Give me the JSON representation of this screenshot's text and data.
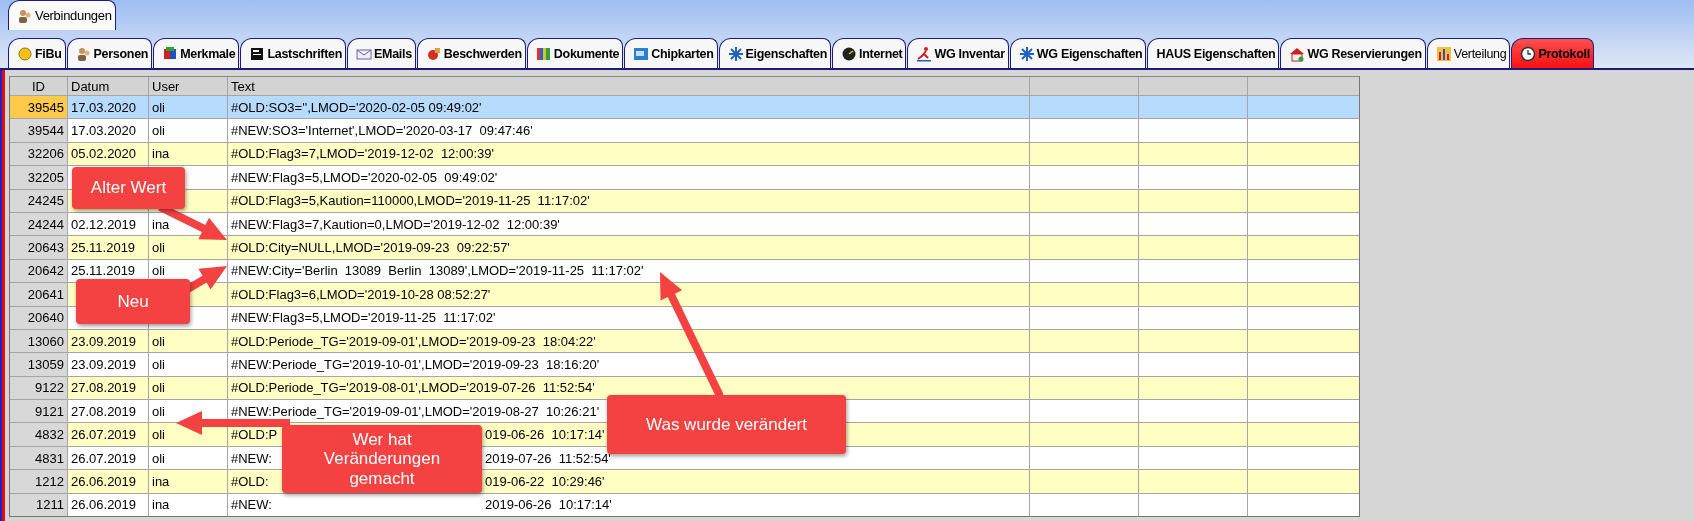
{
  "top_tabs": [
    {
      "label": "Verbindungen",
      "selected": true
    }
  ],
  "tabs": [
    {
      "label": "FiBu",
      "selected": false,
      "bold": true,
      "icon": true
    },
    {
      "label": "Personen",
      "selected": false,
      "bold": true,
      "icon": true
    },
    {
      "label": "Merkmale",
      "selected": false,
      "bold": true,
      "icon": true
    },
    {
      "label": "Lastschriften",
      "selected": false,
      "bold": true,
      "icon": true
    },
    {
      "label": "EMails",
      "selected": false,
      "bold": true,
      "icon": true
    },
    {
      "label": "Beschwerden",
      "selected": false,
      "bold": true,
      "icon": true
    },
    {
      "label": "Dokumente",
      "selected": false,
      "bold": true,
      "icon": true
    },
    {
      "label": "Chipkarten",
      "selected": false,
      "bold": true,
      "icon": true
    },
    {
      "label": "Eigenschaften",
      "selected": false,
      "bold": true,
      "icon": true
    },
    {
      "label": "Internet",
      "selected": false,
      "bold": true,
      "icon": true
    },
    {
      "label": "WG Inventar",
      "selected": false,
      "bold": true,
      "icon": true
    },
    {
      "label": "WG Eigenschaften",
      "selected": false,
      "bold": true,
      "icon": true
    },
    {
      "label": "HAUS Eigenschaften",
      "selected": false,
      "bold": true,
      "icon": false
    },
    {
      "label": "WG Reservierungen",
      "selected": false,
      "bold": true,
      "icon": true
    },
    {
      "label": "Verteilung",
      "selected": false,
      "bold": false,
      "icon": true
    },
    {
      "label": "Protokoll",
      "selected": true,
      "bold": true,
      "icon": true
    }
  ],
  "table": {
    "columns": [
      "ID",
      "Datum",
      "User",
      "Text"
    ],
    "rows": [
      {
        "id": "39545",
        "date": "17.03.2020",
        "user": "oli",
        "text": "#OLD:SO3='',LMOD='2020-02-05 09:49:02'",
        "selected": true
      },
      {
        "id": "39544",
        "date": "17.03.2020",
        "user": "oli",
        "text": "#NEW:SO3='Internet',LMOD='2020-03-17  09:47:46'",
        "selected": false
      },
      {
        "id": "32206",
        "date": "05.02.2020",
        "user": "ina",
        "text": "#OLD:Flag3=7,LMOD='2019-12-02  12:00:39'",
        "selected": false
      },
      {
        "id": "32205",
        "text": "#NEW:Flag3=5,LMOD='2020-02-05  09:49:02'",
        "selected": false
      },
      {
        "id": "24245",
        "text": "#OLD:Flag3=5,Kaution=110000,LMOD='2019-11-25  11:17:02'",
        "selected": false
      },
      {
        "id": "24244",
        "date": "02.12.2019",
        "user": "ina",
        "text": "#NEW:Flag3=7,Kaution=0,LMOD='2019-12-02  12:00:39'",
        "selected": false
      },
      {
        "id": "20643",
        "date": "25.11.2019",
        "user": "oli",
        "text": "#OLD:City=NULL,LMOD='2019-09-23  09:22:57'",
        "selected": false
      },
      {
        "id": "20642",
        "date": "25.11.2019",
        "user": "oli",
        "text": "#NEW:City='Berlin  13089  Berlin  13089',LMOD='2019-11-25  11:17:02'",
        "selected": false
      },
      {
        "id": "20641",
        "text": "#OLD:Flag3=6,LMOD='2019-10-28 08:52:27'",
        "selected": false
      },
      {
        "id": "20640",
        "text": "#NEW:Flag3=5,LMOD='2019-11-25  11:17:02'",
        "selected": false
      },
      {
        "id": "13060",
        "date": "23.09.2019",
        "user": "oli",
        "text": "#OLD:Periode_TG='2019-09-01',LMOD='2019-09-23  18:04:22'",
        "selected": false
      },
      {
        "id": "13059",
        "date": "23.09.2019",
        "user": "oli",
        "text": "#NEW:Periode_TG='2019-10-01',LMOD='2019-09-23  18:16:20'",
        "selected": false
      },
      {
        "id": "9122",
        "date": "27.08.2019",
        "user": "oli",
        "text": "#OLD:Periode_TG='2019-08-01',LMOD='2019-07-26  11:52:54'",
        "selected": false
      },
      {
        "id": "9121",
        "date": "27.08.2019",
        "user": "oli",
        "text": "#NEW:Periode_TG='2019-09-01',LMOD='2019-08-27  10:26:21'",
        "selected": false
      },
      {
        "id": "4832",
        "date": "26.07.2019",
        "user": "oli",
        "text": "#OLD:P",
        "text_end": "019-06-26  10:17:14'",
        "selected": false
      },
      {
        "id": "4831",
        "date": "26.07.2019",
        "user": "oli",
        "text": "#NEW:",
        "text_end": "2019-07-26  11:52:54'",
        "selected": false
      },
      {
        "id": "1212",
        "date": "26.06.2019",
        "user": "ina",
        "text": "#OLD:",
        "text_end": "019-06-22  10:29:46'",
        "selected": false
      },
      {
        "id": "1211",
        "date": "26.06.2019",
        "user": "ina",
        "text": "#NEW:",
        "text_end": "2019-06-26  10:17:14'",
        "selected": false
      }
    ]
  },
  "callouts": [
    {
      "text": "Alter Wert"
    },
    {
      "text": "Neu"
    },
    {
      "text": "Wer hat Veränderungen gemacht"
    },
    {
      "text": "Was wurde verändert"
    }
  ]
}
